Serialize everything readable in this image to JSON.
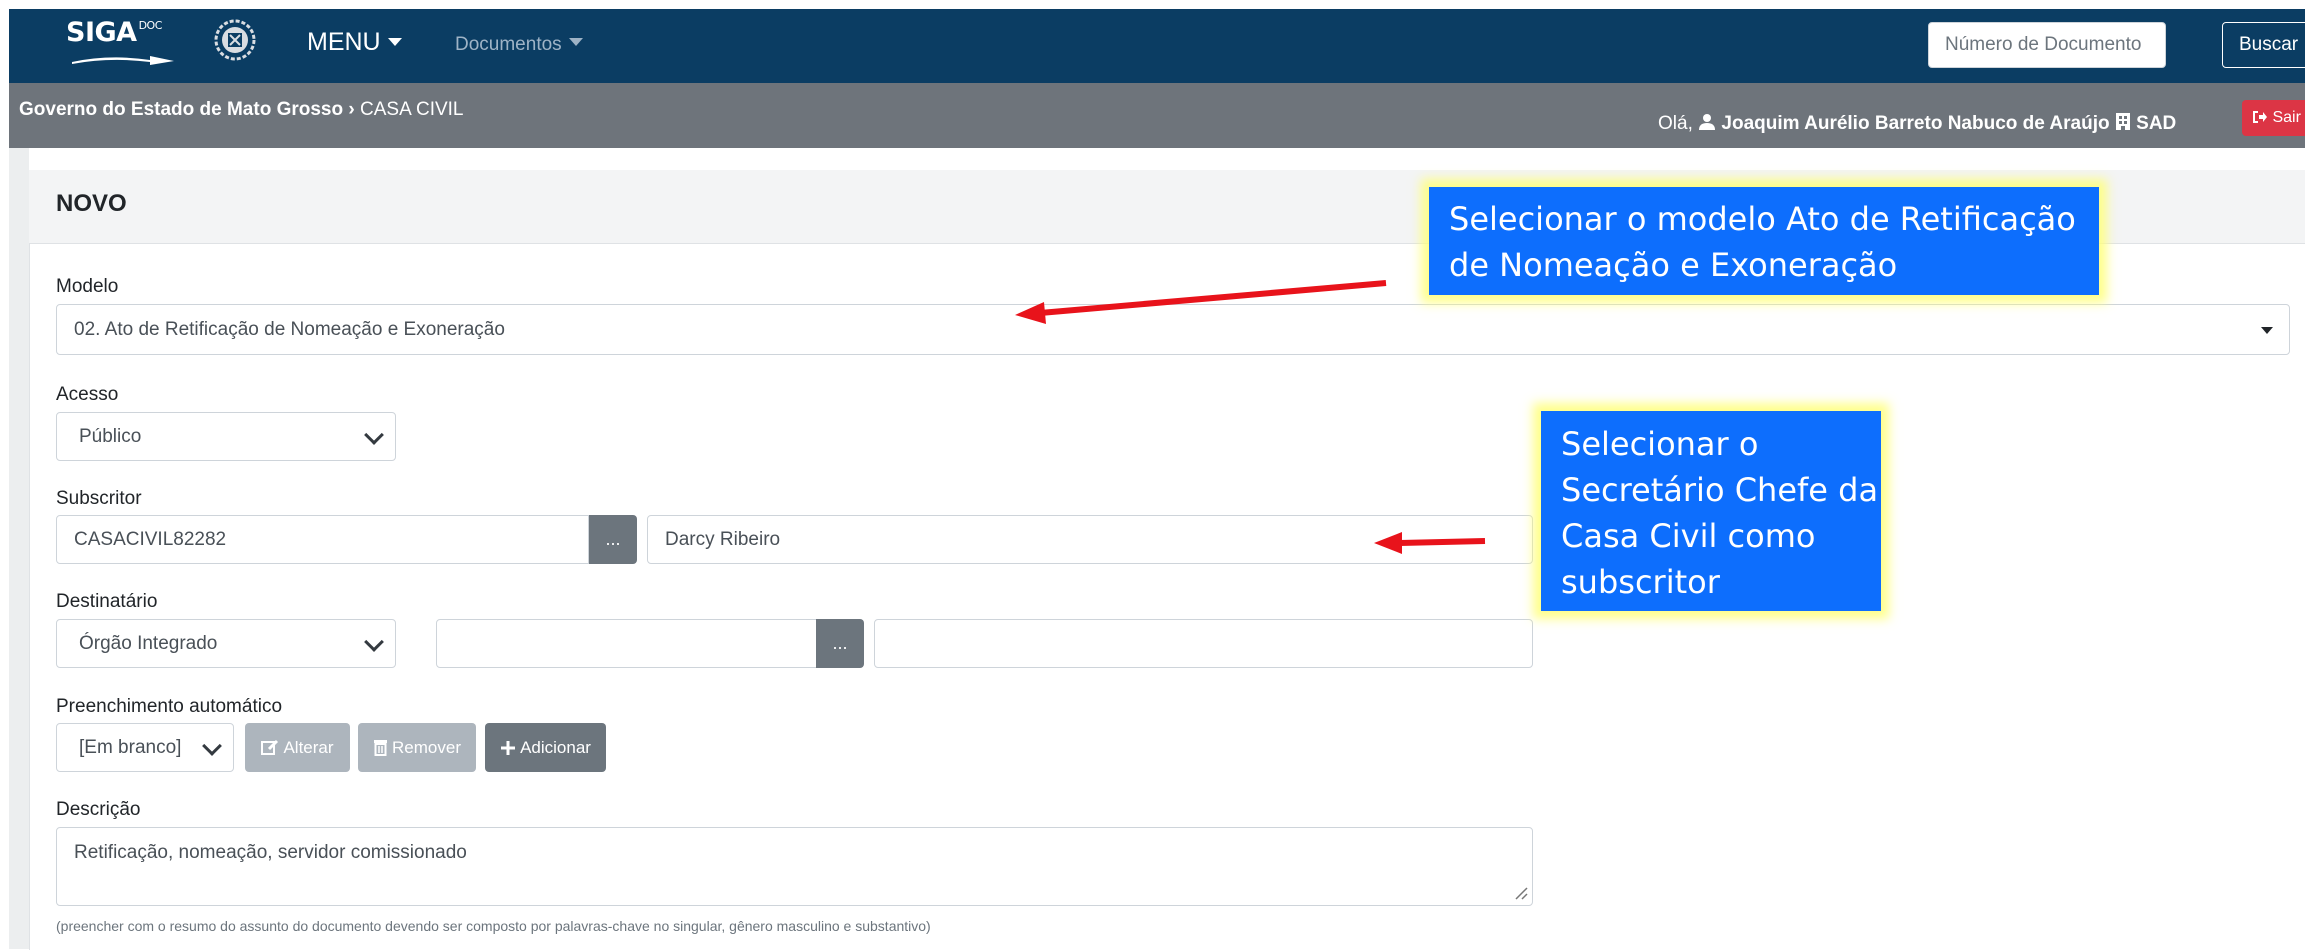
{
  "navbar": {
    "logo_text": "SIGA",
    "logo_sup": "DOC",
    "menu_label": "MENU",
    "documents_label": "Documentos",
    "doc_number_placeholder": "Número de Documento",
    "search_button": "Buscar"
  },
  "subbar": {
    "breadcrumb_org": "Governo do Estado de Mato Grosso",
    "breadcrumb_sep": "›",
    "breadcrumb_unit": "CASA CIVIL",
    "greeting": "Olá,",
    "user_name": "Joaquim Aurélio Barreto Nabuco de Araújo",
    "user_unit": "SAD",
    "logout_label": "Sair"
  },
  "form": {
    "card_title": "NOVO",
    "modelo_label": "Modelo",
    "modelo_value": "02. Ato de Retificação de Nomeação e Exoneração",
    "acesso_label": "Acesso",
    "acesso_value": "Público",
    "subscritor_label": "Subscritor",
    "subscritor_code": "CASACIVIL82282",
    "subscritor_button": "...",
    "subscritor_name": "Darcy Ribeiro",
    "destinatario_label": "Destinatário",
    "destinatario_type": "Órgão Integrado",
    "destinatario_code": "",
    "destinatario_button": "...",
    "destinatario_name": "",
    "preenchimento_label": "Preenchimento automático",
    "preenchimento_value": "[Em branco]",
    "alterar_label": "Alterar",
    "remover_label": "Remover",
    "adicionar_label": "Adicionar",
    "descricao_label": "Descrição",
    "descricao_value": "Retificação, nomeação, servidor comissionado",
    "descricao_hint": "(preencher com o resumo do assunto do documento devendo ser composto por palavras-chave no singular, gênero masculino e substantivo)"
  },
  "annotations": {
    "callout1_lines": [
      "Selecionar  o modelo Ato de Retificação",
      "de Nomeação e Exoneração"
    ],
    "callout2_lines": [
      "Selecionar o",
      "Secretário Chefe da",
      "Casa Civil como",
      "subscritor"
    ],
    "callout_color": "#0d6efd",
    "arrow_color": "#e8131b"
  },
  "colors": {
    "navbar": "#0b3d63",
    "subbar": "#6e747b",
    "danger": "#dc3545"
  }
}
